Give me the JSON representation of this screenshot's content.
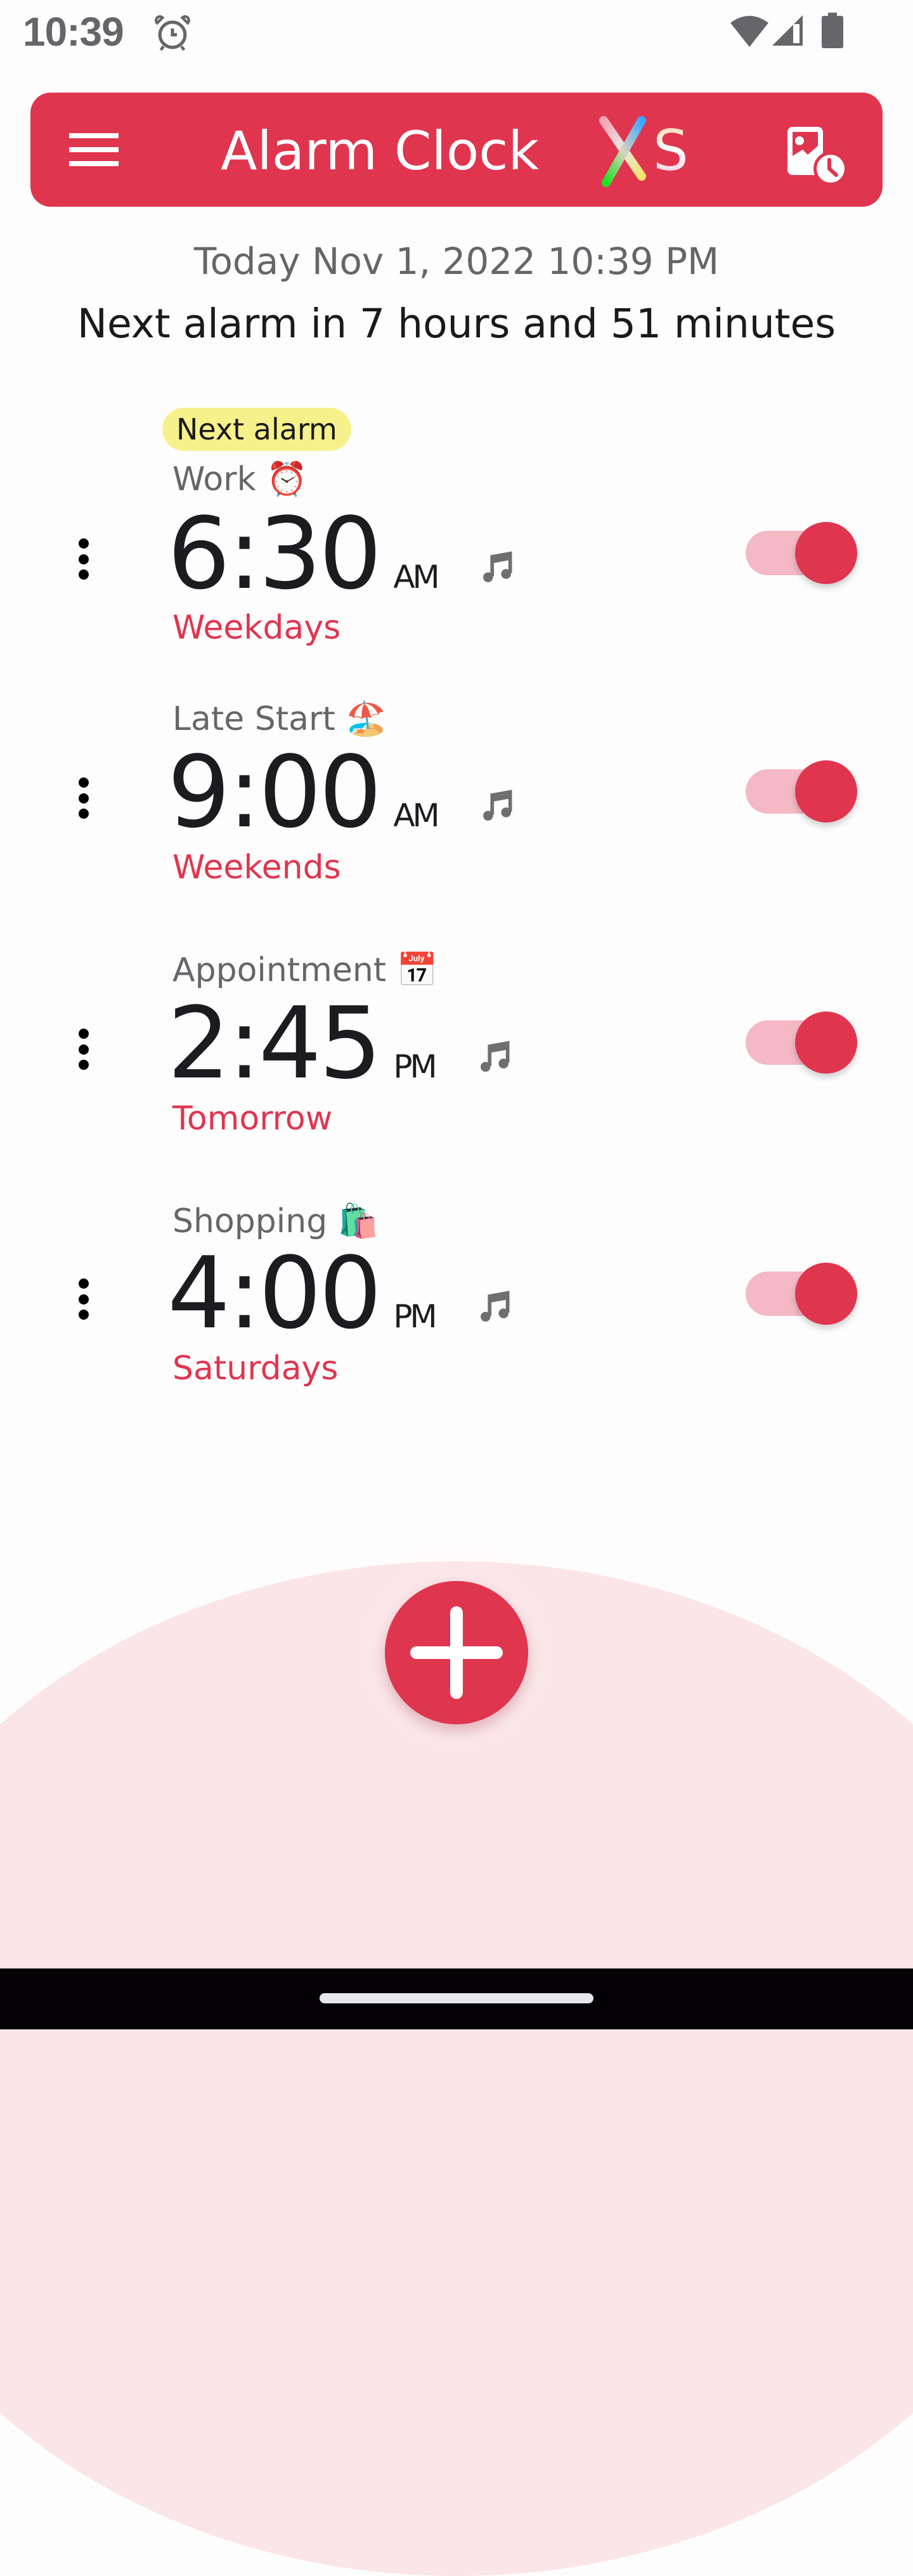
{
  "status_bar": {
    "time": "10:39",
    "icons": [
      "alarm-clock-icon",
      "wifi-icon",
      "cellular-signal-icon",
      "battery-icon"
    ]
  },
  "header": {
    "title": "Alarm Clock",
    "logo_suffix_x": "X",
    "logo_suffix_s": "S",
    "menu_icon": "hamburger-menu-icon",
    "right_icon": "photo-clock-icon",
    "brand_color": "#e0354f"
  },
  "summary": {
    "today": "Today Nov 1, 2022 10:39 PM",
    "next_alarm": "Next alarm in 7 hours and 51 minutes"
  },
  "alarms": [
    {
      "badge": "Next alarm",
      "label": "Work",
      "emoji": "⏰",
      "time": "6:30",
      "ampm": "AM",
      "days": "Weekdays",
      "enabled": true,
      "sound_icon": "music-note-icon"
    },
    {
      "label": "Late Start",
      "emoji": "🏖️",
      "time": "9:00",
      "ampm": "AM",
      "days": "Weekends",
      "enabled": true,
      "sound_icon": "music-note-icon"
    },
    {
      "label": "Appointment",
      "emoji": "📅",
      "time": "2:45",
      "ampm": "PM",
      "days": "Tomorrow",
      "enabled": true,
      "sound_icon": "music-note-icon"
    },
    {
      "label": "Shopping",
      "emoji": "🛍️",
      "time": "4:00",
      "ampm": "PM",
      "days": "Saturdays",
      "enabled": true,
      "sound_icon": "music-note-icon"
    }
  ],
  "fab": {
    "icon": "plus-icon",
    "action": "Add alarm"
  },
  "colors": {
    "accent": "#e0354f",
    "switch_track": "#f4b9c5",
    "badge_bg": "#f7f18c",
    "arc_bg": "#fae5e7",
    "secondary_text": "#666569",
    "primary_text": "#1c1b1f"
  }
}
